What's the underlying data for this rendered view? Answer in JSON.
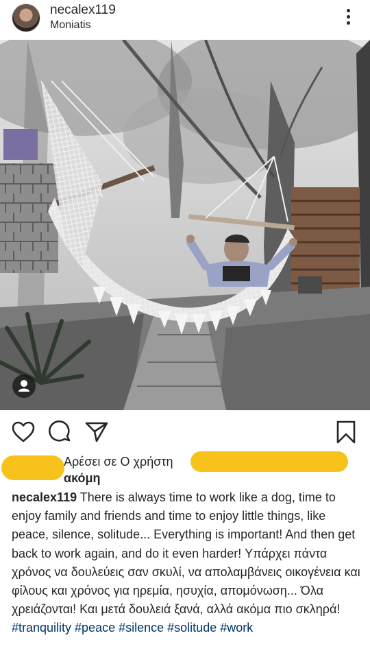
{
  "post": {
    "username": "necalex119",
    "location": "Moniatis"
  },
  "icons": {
    "more": "more-vertical-icon",
    "like": "heart-icon",
    "comment": "comment-icon",
    "share": "paper-plane-icon",
    "save": "bookmark-icon",
    "tagged": "person-icon"
  },
  "likes": {
    "line1": "Αρέσει σε Ο χρήστη",
    "line2": "ακόμη"
  },
  "caption": {
    "username": "necalex119",
    "text": "There is always time to work like a dog, time to enjoy family and friends and time to enjoy little things, like peace, silence, solitude... Everything is important! And then get back to work again, and do it even harder! Υπάρχει πάντα χρόνος να δουλεύεις σαν σκυλί, να απολαμβάνεις οικογένεια και φίλους και χρόνος για ηρεμία, ησυχία, απομόνωση... Όλα χρειάζονται! Και μετά δουλειά ξανά, αλλά ακόμα πιο σκληρά!",
    "hashtags": [
      "#tranquility",
      "#peace",
      "#silence",
      "#solitude",
      "#work"
    ]
  },
  "colors": {
    "text": "#262626",
    "hashtag": "#003569",
    "redaction": "#f7c21c"
  }
}
